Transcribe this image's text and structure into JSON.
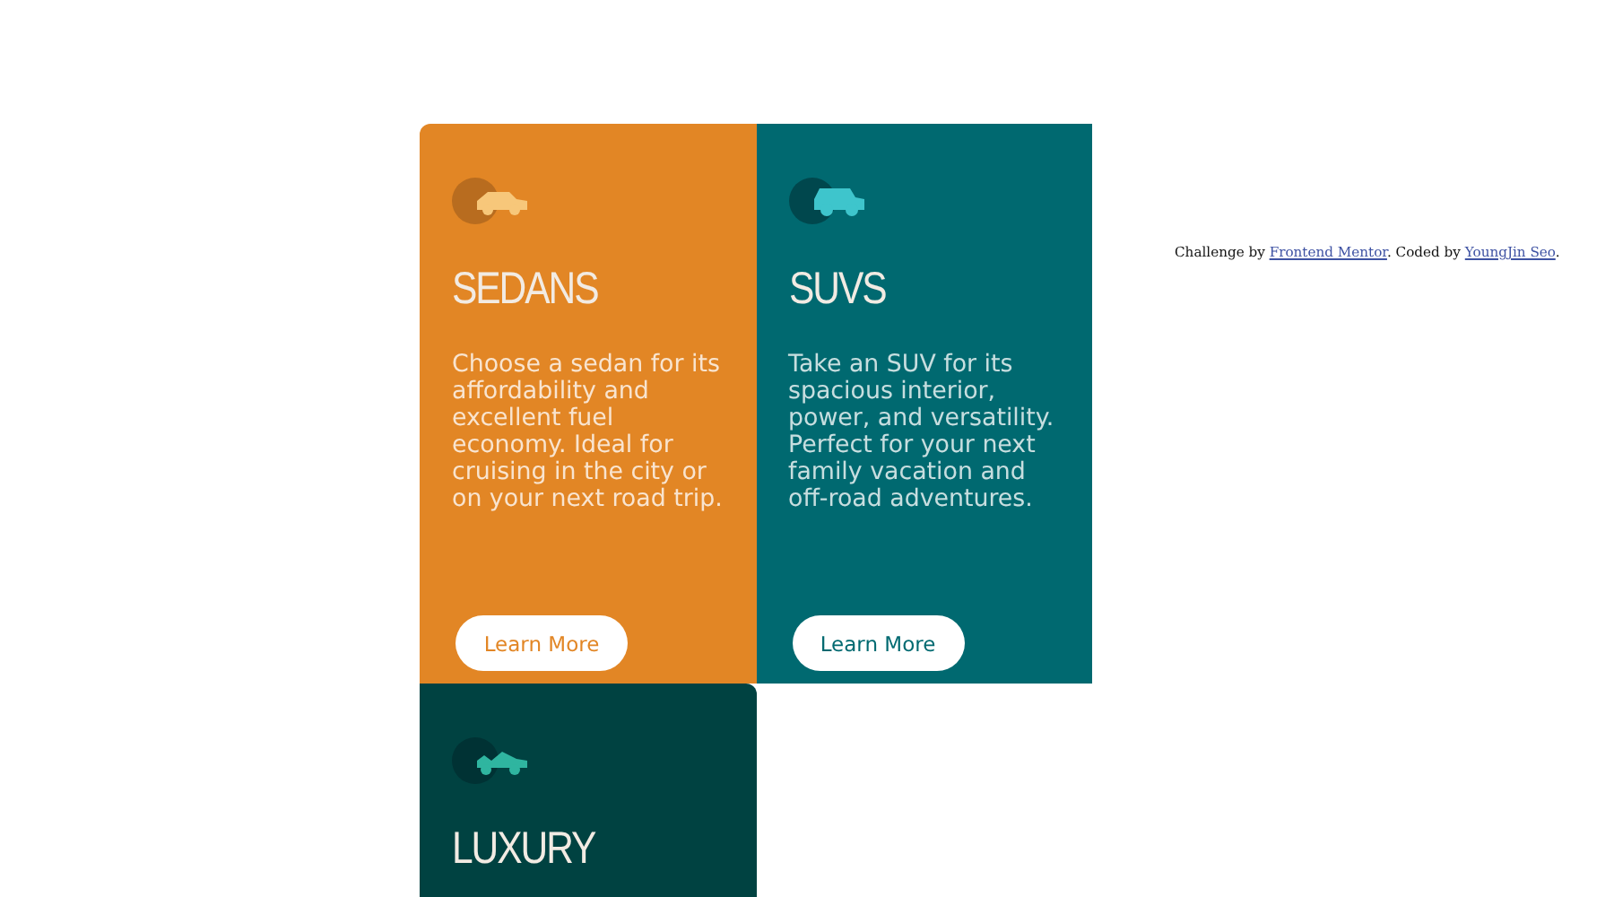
{
  "cards": [
    {
      "kind": "sedan",
      "color": "#e28625",
      "title": "SEDANS",
      "description": "Choose a sedan for its affordability and excellent fuel economy. Ideal for cruising in the city or on your next road trip.",
      "button": "Learn More"
    },
    {
      "kind": "suv",
      "color": "#006970",
      "title": "SUVS",
      "description": "Take an SUV for its spacious interior, power, and versatility. Perfect for your next family vacation and off-road adventures.",
      "button": "Learn More"
    },
    {
      "kind": "luxury",
      "color": "#004241",
      "title": "LUXURY"
    }
  ],
  "attribution": {
    "prefix": "Challenge by",
    "link1": "Frontend Mentor",
    "middle": ". Coded by",
    "link2": "YoungJin Seo",
    "suffix": "."
  }
}
